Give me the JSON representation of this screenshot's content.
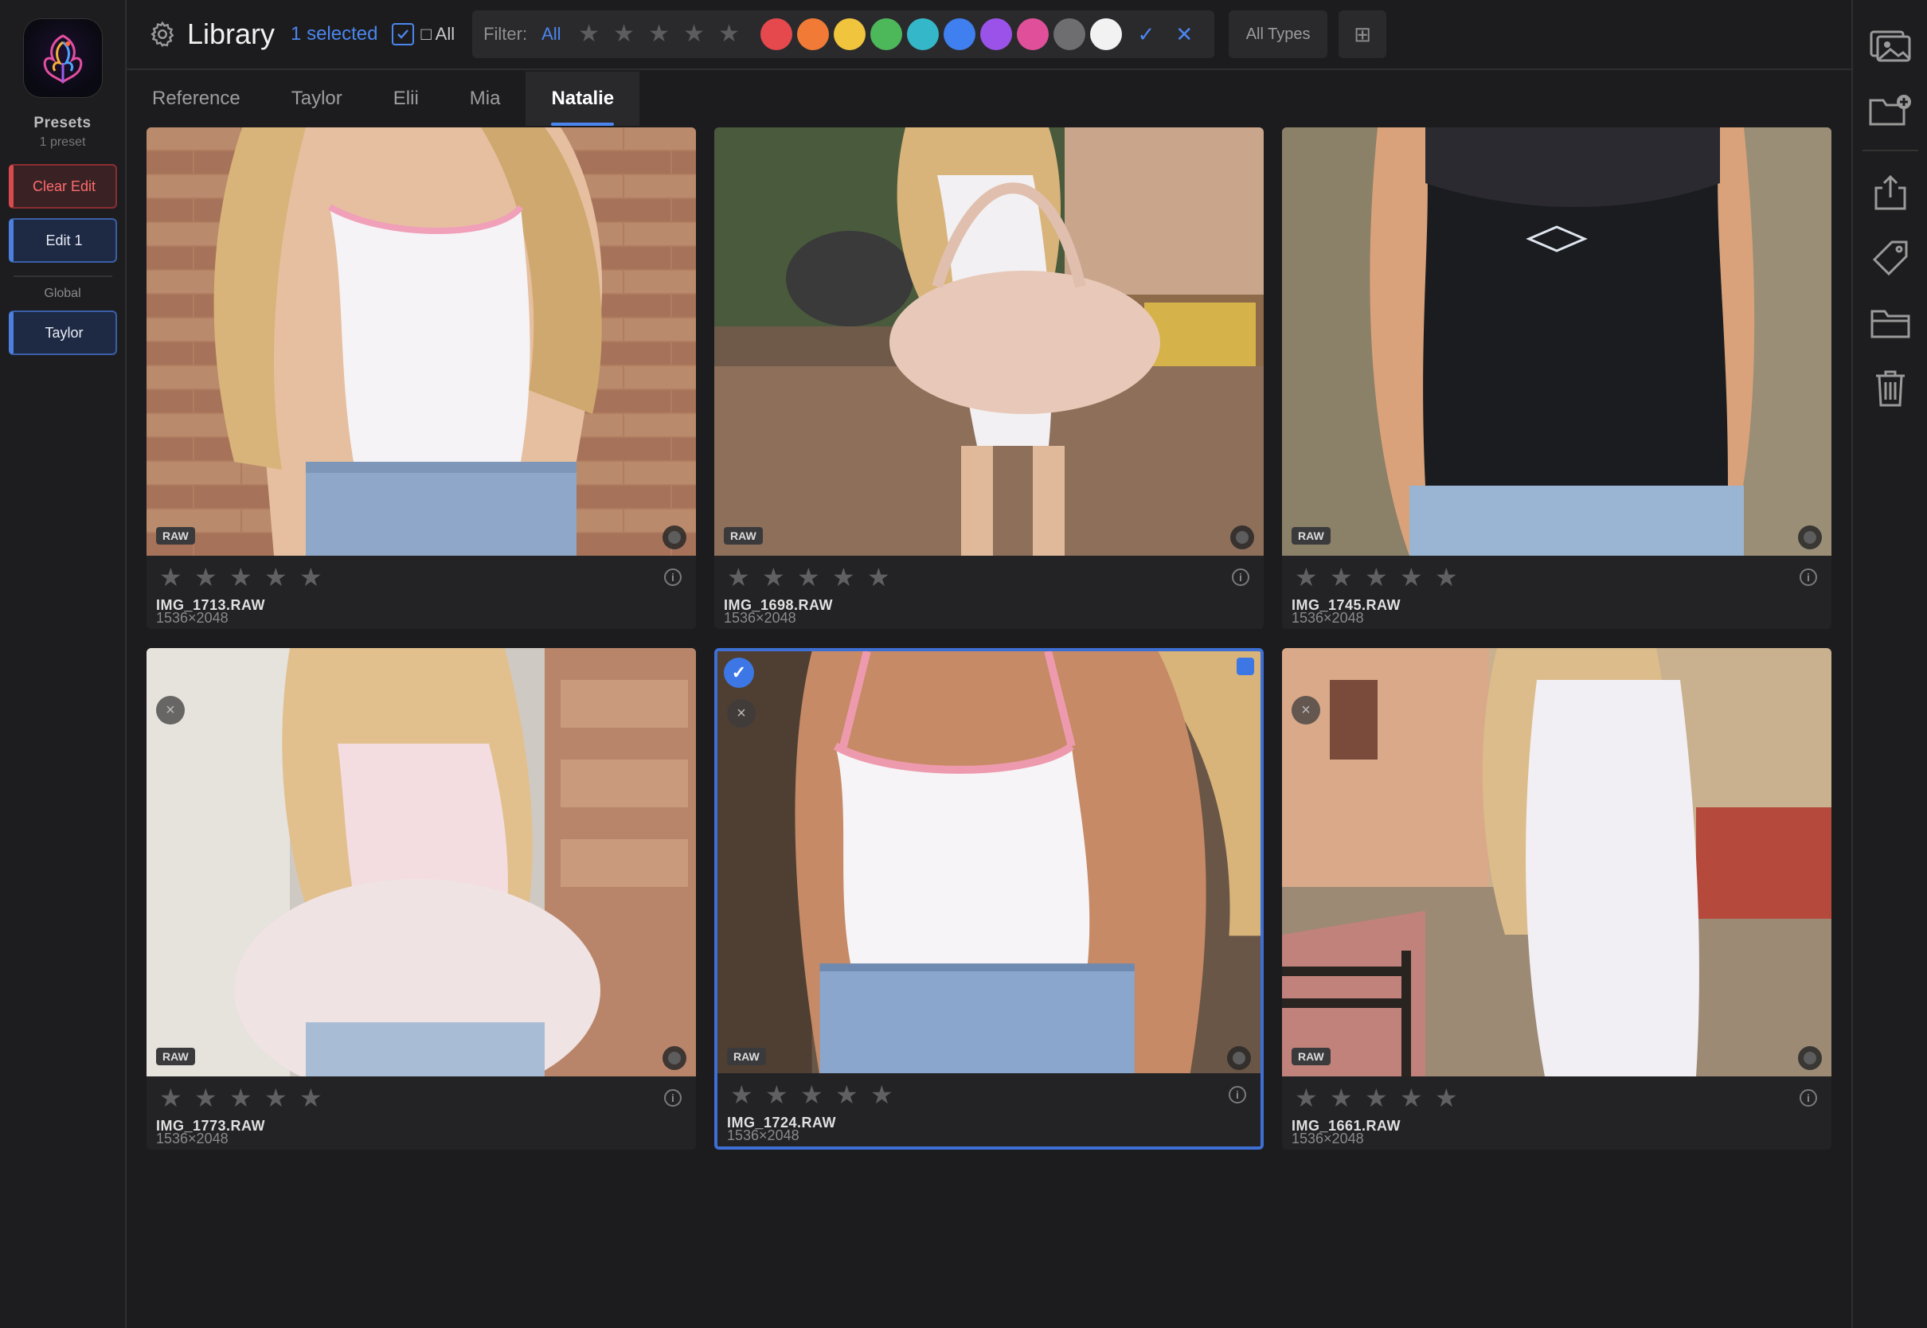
{
  "sidebar": {
    "presets_title": "Presets",
    "presets_count": "1 preset",
    "clear_edit": "Clear Edit",
    "edit_1": "Edit 1",
    "global_label": "Global",
    "taylor": "Taylor"
  },
  "toolbar": {
    "title": "Library",
    "selected": "1 selected",
    "all_label": "□ All",
    "filter_label": "Filter:",
    "filter_all": "All",
    "color_filters": [
      "#e5484d",
      "#f07a36",
      "#f0c43c",
      "#4cb85a",
      "#34b8c9",
      "#3f7ff0",
      "#9a52e8",
      "#e0509a",
      "#6e6e70",
      "#f2f2f2"
    ],
    "confirm_glyph": "✓",
    "clear_glyph": "✕",
    "all_types": "All Types",
    "grid_glyph": "⊞"
  },
  "tabs": [
    {
      "label": "Reference",
      "active": false
    },
    {
      "label": "Taylor",
      "active": false
    },
    {
      "label": "Elii",
      "active": false
    },
    {
      "label": "Mia",
      "active": false
    },
    {
      "label": "Natalie",
      "active": true
    }
  ],
  "cards": [
    {
      "filename": "IMG_1713.RAW",
      "dims": "1536×2048",
      "badge": "RAW",
      "selected": false
    },
    {
      "filename": "IMG_1698.RAW",
      "dims": "1536×2048",
      "badge": "RAW",
      "selected": false
    },
    {
      "filename": "IMG_1745.RAW",
      "dims": "1536×2048",
      "badge": "RAW",
      "selected": false
    },
    {
      "filename": "IMG_1773.RAW",
      "dims": "1536×2048",
      "badge": "RAW",
      "selected": false
    },
    {
      "filename": "IMG_1724.RAW",
      "dims": "1536×2048",
      "badge": "RAW",
      "selected": true
    },
    {
      "filename": "IMG_1661.RAW",
      "dims": "1536×2048",
      "badge": "RAW",
      "selected": false
    }
  ],
  "right_sidebar": {
    "icons": [
      "photo-import-icon",
      "new-folder-icon",
      "export-icon",
      "tag-icon",
      "folder-icon",
      "trash-icon"
    ]
  }
}
